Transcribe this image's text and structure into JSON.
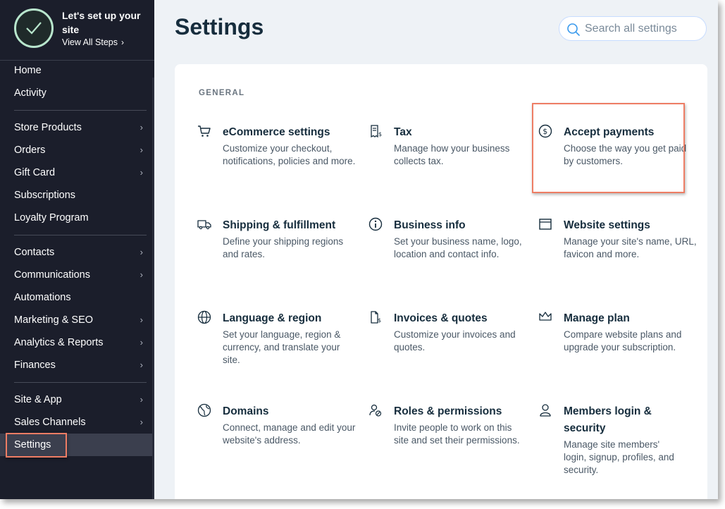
{
  "sidebar": {
    "setup_title": "Let's set up your site",
    "setup_link": "View All Steps",
    "items": [
      {
        "label": "Home",
        "arrow": false
      },
      {
        "label": "Activity",
        "arrow": false
      },
      {
        "label": "Store Products",
        "arrow": true
      },
      {
        "label": "Orders",
        "arrow": true
      },
      {
        "label": "Gift Card",
        "arrow": true
      },
      {
        "label": "Subscriptions",
        "arrow": false
      },
      {
        "label": "Loyalty Program",
        "arrow": false
      },
      {
        "label": "Contacts",
        "arrow": true
      },
      {
        "label": "Communications",
        "arrow": true
      },
      {
        "label": "Automations",
        "arrow": false
      },
      {
        "label": "Marketing & SEO",
        "arrow": true
      },
      {
        "label": "Analytics & Reports",
        "arrow": true
      },
      {
        "label": "Finances",
        "arrow": true
      },
      {
        "label": "Site & App",
        "arrow": true
      },
      {
        "label": "Sales Channels",
        "arrow": true
      },
      {
        "label": "Settings",
        "arrow": false,
        "active": true
      }
    ]
  },
  "main": {
    "title": "Settings",
    "search_placeholder": "Search all settings",
    "section": "GENERAL",
    "tiles": [
      {
        "icon": "cart-icon",
        "title": "eCommerce settings",
        "desc": "Customize your checkout, notifications, policies and more."
      },
      {
        "icon": "tax-receipt-icon",
        "title": "Tax",
        "desc": "Manage how your business collects tax."
      },
      {
        "icon": "dollar-circle-icon",
        "title": "Accept payments",
        "desc": "Choose the way you get paid by customers."
      },
      {
        "icon": "truck-icon",
        "title": "Shipping & fulfillment",
        "desc": "Define your shipping regions and rates."
      },
      {
        "icon": "info-icon",
        "title": "Business info",
        "desc": "Set your business name, logo, location and contact info."
      },
      {
        "icon": "browser-window-icon",
        "title": "Website settings",
        "desc": "Manage your site's name, URL, favicon and more."
      },
      {
        "icon": "globe-icon",
        "title": "Language & region",
        "desc": "Set your language, region & currency, and translate your site."
      },
      {
        "icon": "invoice-icon",
        "title": "Invoices & quotes",
        "desc": "Customize your invoices and quotes."
      },
      {
        "icon": "crown-icon",
        "title": "Manage plan",
        "desc": "Compare website plans and upgrade your subscription."
      },
      {
        "icon": "domain-globe-icon",
        "title": "Domains",
        "desc": "Connect, manage and edit your website's address."
      },
      {
        "icon": "user-permissions-icon",
        "title": "Roles & permissions",
        "desc": "Invite people to work on this site and set their permissions."
      },
      {
        "icon": "member-icon",
        "title": "Members login & security",
        "desc": "Manage site members' login, signup, profiles, and security."
      }
    ]
  },
  "colors": {
    "sidebar_bg": "#1b1e2b",
    "highlight": "#ee7d64",
    "check_ring": "#b8e6cd"
  }
}
